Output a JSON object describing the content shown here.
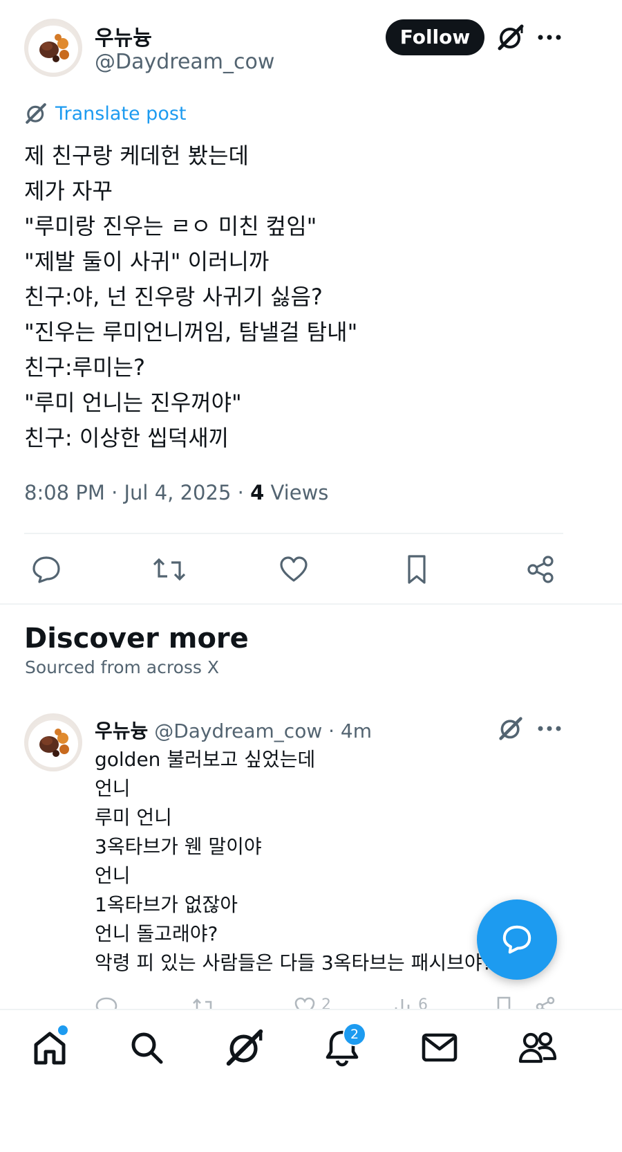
{
  "post": {
    "author_name": "우뉴늉",
    "author_handle": "@Daydream_cow",
    "follow_label": "Follow",
    "translate_label": "Translate post",
    "lines": [
      "제 친구랑 케데헌 봤는데",
      "제가 자꾸",
      "\"루미랑 진우는 ㄹㅇ 미친 컾임\"",
      "\"제발 둘이 사귀\" 이러니까",
      "친구:야, 넌 진우랑 사귀기 싫음?",
      "\"진우는 루미언니꺼임, 탐낼걸 탐내\"",
      "친구:루미는?",
      "\"루미 언니는 진우꺼야\"",
      "친구: 이상한 씹덕새끼"
    ],
    "time": "8:08 PM · Jul 4, 2025 · ",
    "views_count": "4",
    "views_label": " Views",
    "actions": [
      "reply-icon",
      "repost-icon",
      "like-icon",
      "bookmark-icon",
      "share-icon"
    ]
  },
  "discover": {
    "title": "Discover more",
    "subtitle": "Sourced from across X"
  },
  "reply": {
    "author_name": "우뉴늉",
    "author_handle": "@Daydream_cow",
    "time": " · 4m",
    "lines": [
      "golden 불러보고 싶었는데",
      "언니",
      "루미 언니",
      "3옥타브가 웬 말이야",
      "언니",
      "1옥타브가 없잖아",
      "언니 돌고래야?",
      "악령 피 있는 사람들은 다들 3옥타브는 패시브야?"
    ],
    "likes": "2",
    "views": "6"
  },
  "nav": {
    "notification_count": "2",
    "items": [
      "home-icon",
      "search-icon",
      "grok-icon",
      "notifications-icon",
      "messages-icon",
      "communities-icon"
    ]
  },
  "colors": {
    "accent": "#1d9bf0",
    "text": "#0f1419",
    "muted": "#536471",
    "divider": "#eff3f4"
  }
}
